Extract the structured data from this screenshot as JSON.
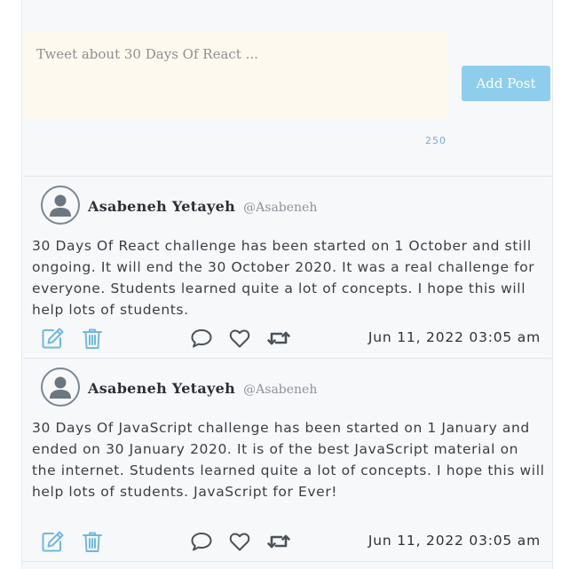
{
  "compose": {
    "placeholder": "Tweet about 30 Days Of React ...",
    "value": "",
    "add_post_label": "Add Post",
    "char_count": "250"
  },
  "colors": {
    "accent": "#8fcdec",
    "action_icon": "#6fb8e0",
    "muted_icon": "#4a5258",
    "input_bg": "#fdf9ef"
  },
  "posts": [
    {
      "author": "Asabeneh Yetayeh",
      "handle": "@Asabeneh",
      "text": "30 Days Of React challenge has been started on 1 October and still ongoing. It will end the 30 October 2020. It was a real challenge for everyone. Students learned quite a lot of concepts. I hope this will help lots of students.",
      "date": "Jun 11, 2022 03:05 am",
      "icons": [
        "user-avatar-icon",
        "edit-icon",
        "trash-icon",
        "comment-icon",
        "heart-icon",
        "retweet-icon"
      ]
    },
    {
      "author": "Asabeneh Yetayeh",
      "handle": "@Asabeneh",
      "text": "30 Days Of JavaScript challenge has been started on 1 January and ended on 30 January 2020. It is of the best JavaScript material on the internet. Students learned quite a lot of concepts. I hope this will help lots of students. JavaScript for Ever!",
      "date": "Jun 11, 2022 03:05 am",
      "icons": [
        "user-avatar-icon",
        "edit-icon",
        "trash-icon",
        "comment-icon",
        "heart-icon",
        "retweet-icon"
      ]
    }
  ]
}
